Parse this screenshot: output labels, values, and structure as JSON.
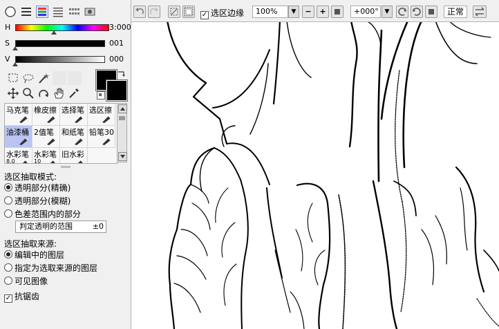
{
  "color_panel": {
    "mode_buttons": [
      "circle-wheel",
      "rgb-sliders",
      "hsv-sliders",
      "palette-grid",
      "swatch-grid",
      "scratch-pad"
    ],
    "h": {
      "label": "H",
      "value": "3:000"
    },
    "s": {
      "label": "S",
      "value": "001"
    },
    "v": {
      "label": "V",
      "value": "000"
    },
    "h_level": 0.41,
    "s_level": 0.0,
    "v_level": 0.0,
    "foreground_color": "#000000",
    "background_color": "#000000"
  },
  "brushes": [
    {
      "label": "马克笔",
      "icon": "marker-icon"
    },
    {
      "label": "橡皮擦",
      "icon": "eraser-icon"
    },
    {
      "label": "选择笔",
      "icon": "select-pen-icon"
    },
    {
      "label": "选区擦",
      "icon": "select-eraser-icon"
    },
    {
      "label": "油漆桶",
      "icon": "bucket-icon",
      "selected": true
    },
    {
      "label": "2值笔",
      "icon": "binary-pen-icon"
    },
    {
      "label": "和纸笔",
      "icon": "washi-pen-icon"
    },
    {
      "label": "铅笔30",
      "icon": "pencil-icon"
    },
    {
      "label": "水彩笔",
      "sub": "8.0",
      "icon": "watercolor-icon"
    },
    {
      "label": "水彩笔",
      "sub": "10",
      "icon": "watercolor-icon"
    },
    {
      "label": "旧水彩",
      "icon": "old-watercolor-icon"
    }
  ],
  "selection_options": {
    "mode_heading": "选区抽取模式:",
    "modes": [
      "透明部分(精确)",
      "透明部分(模糊)",
      "色差范围内的部分"
    ],
    "selected_mode": 0,
    "range_label": "判定透明的范围",
    "range_value": "±0",
    "source_heading": "选区抽取来源:",
    "sources": [
      "编辑中的图层",
      "指定为选取来源的图层",
      "可见图像"
    ],
    "selected_source": 0,
    "antialias_label": "抗锯齿",
    "antialias_checked": true
  },
  "topbar": {
    "selection_edge_label": "选区边缘",
    "selection_edge_checked": true,
    "zoom_value": "100%",
    "rotation_value": "+000°",
    "blend_mode": "正常"
  },
  "colors": {
    "selected_brush_bg": "#b9c4f2",
    "panel_bg": "#f0f0f0"
  }
}
